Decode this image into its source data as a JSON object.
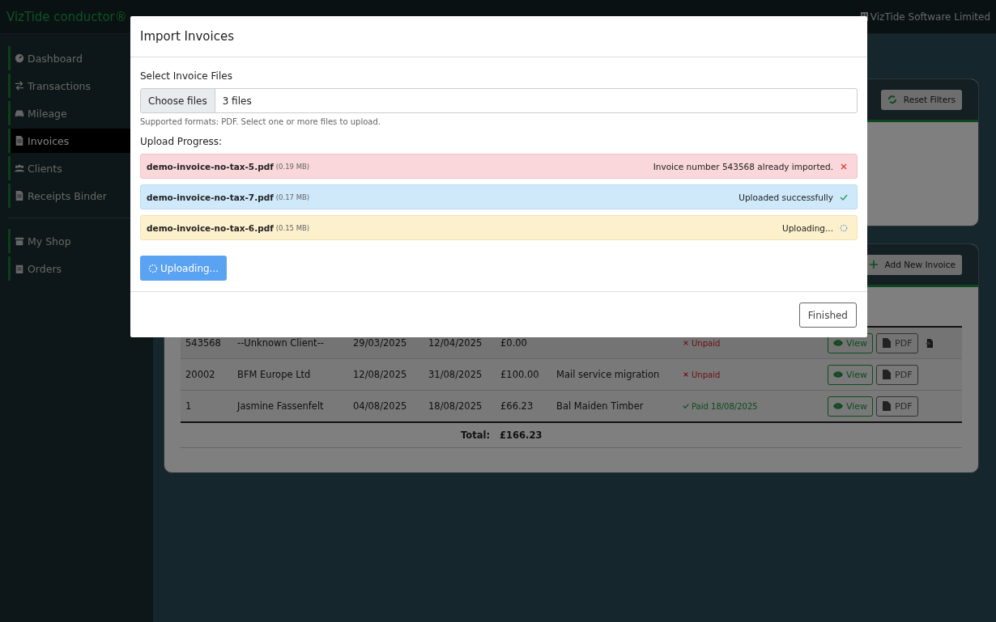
{
  "app": {
    "brand": "VizTide conductor®",
    "company": "VizTide Software Limited"
  },
  "sidebar": {
    "groups": [
      {
        "items": [
          {
            "label": "Dashboard",
            "kind": "gauge",
            "selected": false
          },
          {
            "label": "Transactions",
            "kind": "arrows",
            "selected": false
          },
          {
            "label": "Mileage",
            "kind": "car",
            "selected": false
          },
          {
            "label": "Invoices",
            "kind": "invoice",
            "selected": true
          },
          {
            "label": "Clients",
            "kind": "users",
            "selected": false
          },
          {
            "label": "Receipts Binder",
            "kind": "receipt",
            "selected": false
          }
        ]
      },
      {
        "items": [
          {
            "label": "My Shop",
            "kind": "shop",
            "selected": false
          },
          {
            "label": "Orders",
            "kind": "clipboard",
            "selected": false
          }
        ]
      }
    ]
  },
  "filters_panel": {
    "button": "Reset Filters"
  },
  "invoices_panel": {
    "button": "Add New Invoice",
    "rows": [
      {
        "cells": [
          "543568",
          "--Unknown Client--",
          "29/03/2025",
          "12/04/2025",
          "£0.00",
          ""
        ],
        "status": {
          "kind": "unpaid",
          "text": "Unpaid"
        },
        "view": "View",
        "pdf": "PDF",
        "import_action": true
      },
      {
        "cells": [
          "20002",
          "BFM Europe Ltd",
          "12/08/2025",
          "31/08/2025",
          "£100.00",
          "Mail service migration"
        ],
        "status": {
          "kind": "unpaid",
          "text": "Unpaid"
        },
        "view": "View",
        "pdf": "PDF",
        "import_action": false
      },
      {
        "cells": [
          "1",
          "Jasmine Fassenfelt",
          "04/08/2025",
          "18/08/2025",
          "£66.23",
          "Bal Maiden Timber"
        ],
        "status": {
          "kind": "paid",
          "text": "Paid 18/08/2025"
        },
        "view": "View",
        "pdf": "PDF",
        "import_action": false
      }
    ],
    "total_label": "Total:",
    "total": "£166.23"
  },
  "modal": {
    "title": "Import Invoices",
    "file_label": "Select Invoice Files",
    "choose": "Choose files",
    "file_value": "3 files",
    "help": "Supported formats: PDF. Select one or more files to upload.",
    "progress_label": "Upload Progress:",
    "uploads": [
      {
        "name": "demo-invoice-no-tax-5.pdf",
        "size": "(0.19 MB)",
        "kind": "error",
        "message": "Invoice number 543568 already imported."
      },
      {
        "name": "demo-invoice-no-tax-7.pdf",
        "size": "(0.17 MB)",
        "kind": "success",
        "message": "Uploaded successfully"
      },
      {
        "name": "demo-invoice-no-tax-6.pdf",
        "size": "(0.15 MB)",
        "kind": "uploading",
        "message": "Uploading..."
      }
    ],
    "upload_button": "Uploading...",
    "finished": "Finished"
  }
}
